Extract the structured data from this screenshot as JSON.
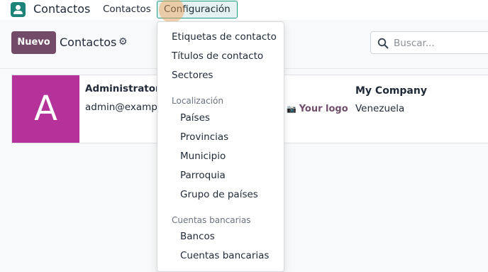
{
  "app": {
    "name": "Contactos",
    "brand_color": "#1e8479",
    "icon": "contacts-app-icon"
  },
  "menu": {
    "contactos": "Contactos",
    "configuracion": "Configuración"
  },
  "control_panel": {
    "new_button": "Nuevo",
    "breadcrumb": "Contactos",
    "actions_icon": "gear-icon",
    "search_placeholder": "Buscar..."
  },
  "kanban": {
    "cards": [
      {
        "avatar_letter": "A",
        "avatar_color": "#b5329a",
        "name": "Administrator",
        "email": "admin@exampl"
      }
    ],
    "company": {
      "logo_text": "Your logo",
      "name": "My Company",
      "country": "Venezuela"
    }
  },
  "dropdown": {
    "items_top": [
      "Etiquetas de contacto",
      "Títulos de contacto",
      "Sectores"
    ],
    "localizacion": {
      "header": "Localización",
      "items": [
        "Países",
        "Provincias",
        "Municipio",
        "Parroquia",
        "Grupo de países"
      ]
    },
    "cuentas": {
      "header": "Cuentas bancarias",
      "items": [
        "Bancos",
        "Cuentas bancarias"
      ]
    }
  },
  "colors": {
    "primary": "#714b67",
    "active_menu_border": "#1e9a8a"
  }
}
